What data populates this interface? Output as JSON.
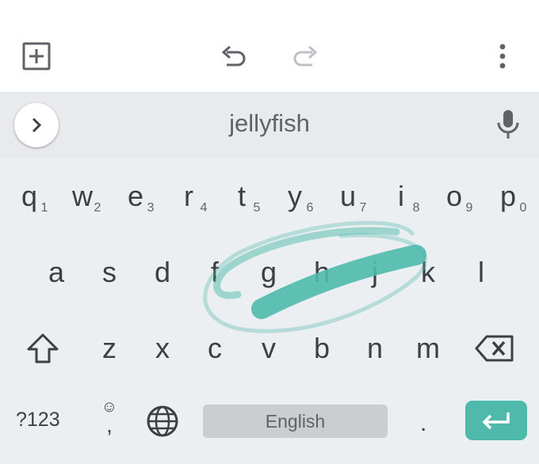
{
  "toolbar": {
    "icons": [
      "add-box-icon",
      "undo-icon",
      "redo-icon",
      "more-vert-icon"
    ]
  },
  "suggestion": {
    "word": "jellyfish",
    "icons": [
      "chevron-right-icon",
      "microphone-icon"
    ]
  },
  "rows": {
    "top": [
      {
        "key": "q",
        "hint": "1"
      },
      {
        "key": "w",
        "hint": "2"
      },
      {
        "key": "e",
        "hint": "3"
      },
      {
        "key": "r",
        "hint": "4"
      },
      {
        "key": "t",
        "hint": "5"
      },
      {
        "key": "y",
        "hint": "6"
      },
      {
        "key": "u",
        "hint": "7"
      },
      {
        "key": "i",
        "hint": "8"
      },
      {
        "key": "o",
        "hint": "9"
      },
      {
        "key": "p",
        "hint": "0"
      }
    ],
    "middle": [
      "a",
      "s",
      "d",
      "f",
      "g",
      "h",
      "j",
      "k",
      "l"
    ],
    "bottom": [
      "z",
      "x",
      "c",
      "v",
      "b",
      "n",
      "m"
    ]
  },
  "bottom_bar": {
    "symbols_label": "?123",
    "emoji_glyph": "☺",
    "comma_label": ",",
    "space_label": "English",
    "period_label": "."
  },
  "colors": {
    "accent": "#4fb9ac",
    "keyboard_bg": "#eceff1",
    "suggestion_bg": "#e8eaed",
    "key_text": "#3c4043"
  },
  "icons": [
    "shift-icon",
    "backspace-icon",
    "globe-icon",
    "enter-icon"
  ]
}
